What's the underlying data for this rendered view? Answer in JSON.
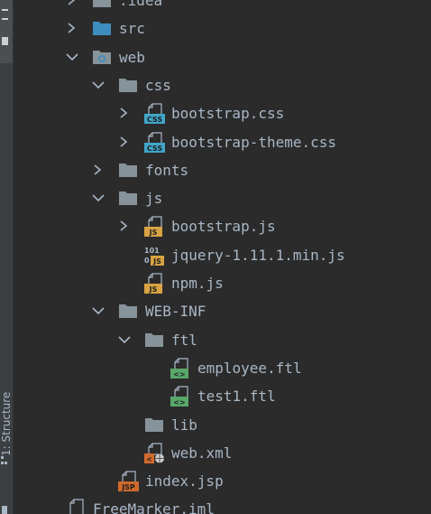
{
  "sidebar": {
    "vertical_label": "1: Structure"
  },
  "tree": {
    "nodes": [
      {
        "label": ".idea",
        "icon": "folder",
        "expand": "collapsed",
        "level": 1
      },
      {
        "label": "src",
        "icon": "source-folder",
        "expand": "collapsed",
        "level": 1
      },
      {
        "label": "web",
        "icon": "web-folder",
        "expand": "expanded",
        "level": 1
      },
      {
        "label": "css",
        "icon": "folder",
        "expand": "expanded",
        "level": 2
      },
      {
        "label": "bootstrap.css",
        "icon": "css-file",
        "expand": "collapsed",
        "level": 3
      },
      {
        "label": "bootstrap-theme.css",
        "icon": "css-file",
        "expand": "collapsed",
        "level": 3
      },
      {
        "label": "fonts",
        "icon": "folder",
        "expand": "collapsed",
        "level": 2
      },
      {
        "label": "js",
        "icon": "folder",
        "expand": "expanded",
        "level": 2
      },
      {
        "label": "bootstrap.js",
        "icon": "js-file",
        "expand": "collapsed",
        "level": 3
      },
      {
        "label": "jquery-1.11.1.min.js",
        "icon": "min-js-file",
        "expand": "none",
        "level": 3
      },
      {
        "label": "npm.js",
        "icon": "js-file",
        "expand": "none",
        "level": 3
      },
      {
        "label": "WEB-INF",
        "icon": "folder",
        "expand": "expanded",
        "level": 2
      },
      {
        "label": "ftl",
        "icon": "folder",
        "expand": "expanded",
        "level": 3
      },
      {
        "label": "employee.ftl",
        "icon": "ftl-file",
        "expand": "none",
        "level": 4
      },
      {
        "label": "test1.ftl",
        "icon": "ftl-file",
        "expand": "none",
        "level": 4
      },
      {
        "label": "lib",
        "icon": "folder",
        "expand": "none",
        "level": 3
      },
      {
        "label": "web.xml",
        "icon": "xml-file",
        "expand": "none",
        "level": 3
      },
      {
        "label": "index.jsp",
        "icon": "jsp-file",
        "expand": "none",
        "level": 2
      },
      {
        "label": "FreeMarker.iml",
        "icon": "iml-file",
        "expand": "none",
        "level": 0
      }
    ]
  },
  "colors": {
    "background": "#2b2b2b",
    "text": "#a9b7c6",
    "folder": "#87939a",
    "source_folder": "#3d8dbf",
    "css_badge": "#40a6c9",
    "js_badge": "#d9a343",
    "ftl_badge": "#59a869",
    "jsp_badge": "#d06a2c"
  }
}
